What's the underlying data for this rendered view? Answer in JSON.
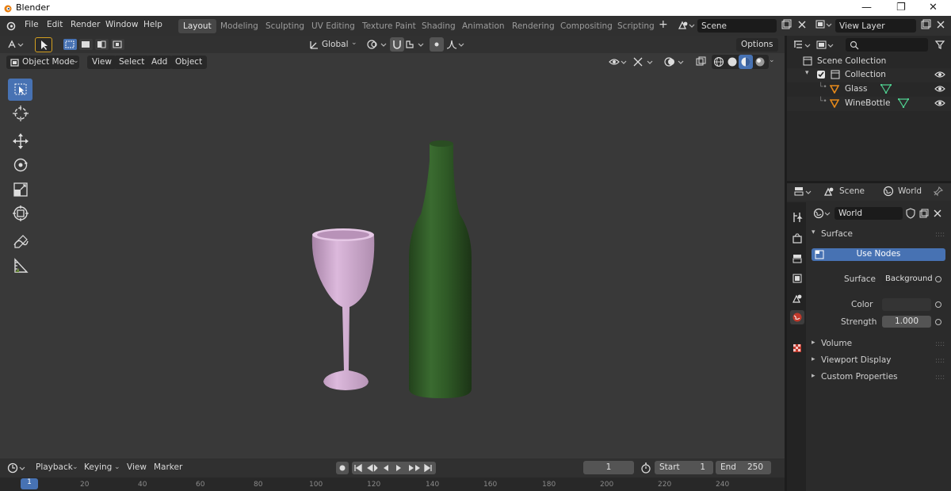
{
  "window": {
    "title": "Blender"
  },
  "menu": {
    "file": "File",
    "edit": "Edit",
    "render": "Render",
    "window": "Window",
    "help": "Help"
  },
  "workspaces": [
    "Layout",
    "Modeling",
    "Sculpting",
    "UV Editing",
    "Texture Paint",
    "Shading",
    "Animation",
    "Rendering",
    "Compositing",
    "Scripting"
  ],
  "scene_field": "Scene",
  "view_layer_field": "View Layer",
  "viewport": {
    "mode": "Object Mode",
    "menus": [
      "View",
      "Select",
      "Add",
      "Object"
    ],
    "orientation": "Global",
    "options": "Options"
  },
  "outliner": {
    "scene_collection": "Scene Collection",
    "collection": "Collection",
    "objects": [
      "Glass",
      "WineBottle"
    ]
  },
  "properties": {
    "breadcrumb_scene": "Scene",
    "breadcrumb_world": "World",
    "world_name": "World",
    "panel_surface": "Surface",
    "use_nodes": "Use Nodes",
    "surface_label": "Surface",
    "surface_value": "Background",
    "color_label": "Color",
    "strength_label": "Strength",
    "strength_value": "1.000",
    "panels_closed": [
      "Volume",
      "Viewport Display",
      "Custom Properties"
    ]
  },
  "timeline": {
    "playback": "Playback",
    "keying": "Keying",
    "view": "View",
    "marker": "Marker",
    "current_frame": "1",
    "start_label": "Start",
    "start_value": "1",
    "end_label": "End",
    "end_value": "250",
    "ruler": [
      "1",
      "20",
      "40",
      "60",
      "80",
      "100",
      "120",
      "140",
      "160",
      "180",
      "200",
      "220",
      "240"
    ]
  },
  "colors": {
    "accent": "#4772b3",
    "bottle": "#2f5a26",
    "glass": "#c9a3c9",
    "viewport_bg": "#393939"
  }
}
